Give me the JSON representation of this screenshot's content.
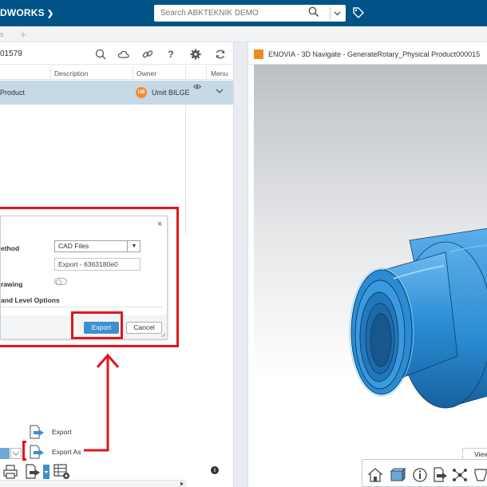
{
  "header": {
    "brand": "DWORKS",
    "search_placeholder": "Search ABKTEKNIK DEMO"
  },
  "subbar": {
    "text": "s"
  },
  "left_panel": {
    "object_id": "01579",
    "columns": [
      "Description",
      "Owner",
      "Menu"
    ],
    "rows": [
      {
        "name": "Product",
        "owner_initials": "UB",
        "owner": "Umit BILGE"
      }
    ]
  },
  "dialog": {
    "labels": {
      "method": "ethod",
      "drawing": "rawing",
      "level_options": "and Level Options"
    },
    "method_value": "CAD Files",
    "name_value": "Export - 6363180e0",
    "export_label": "Export",
    "cancel_label": "Cancel"
  },
  "context_menu": {
    "items": [
      {
        "label": "Export",
        "icon": "export-icon"
      },
      {
        "label": "Export As",
        "icon": "export-as-icon"
      }
    ]
  },
  "right_panel": {
    "title": "ENOVIA - 3D Navigate - GenerateRotary_Physical Product000015",
    "view_tab": "View"
  },
  "colors": {
    "topbar": "#005386",
    "selected_row": "#c5d9e7",
    "primary_button": "#3d8fd1",
    "annotation": "#e0161d",
    "part": "#2d8fd5"
  }
}
